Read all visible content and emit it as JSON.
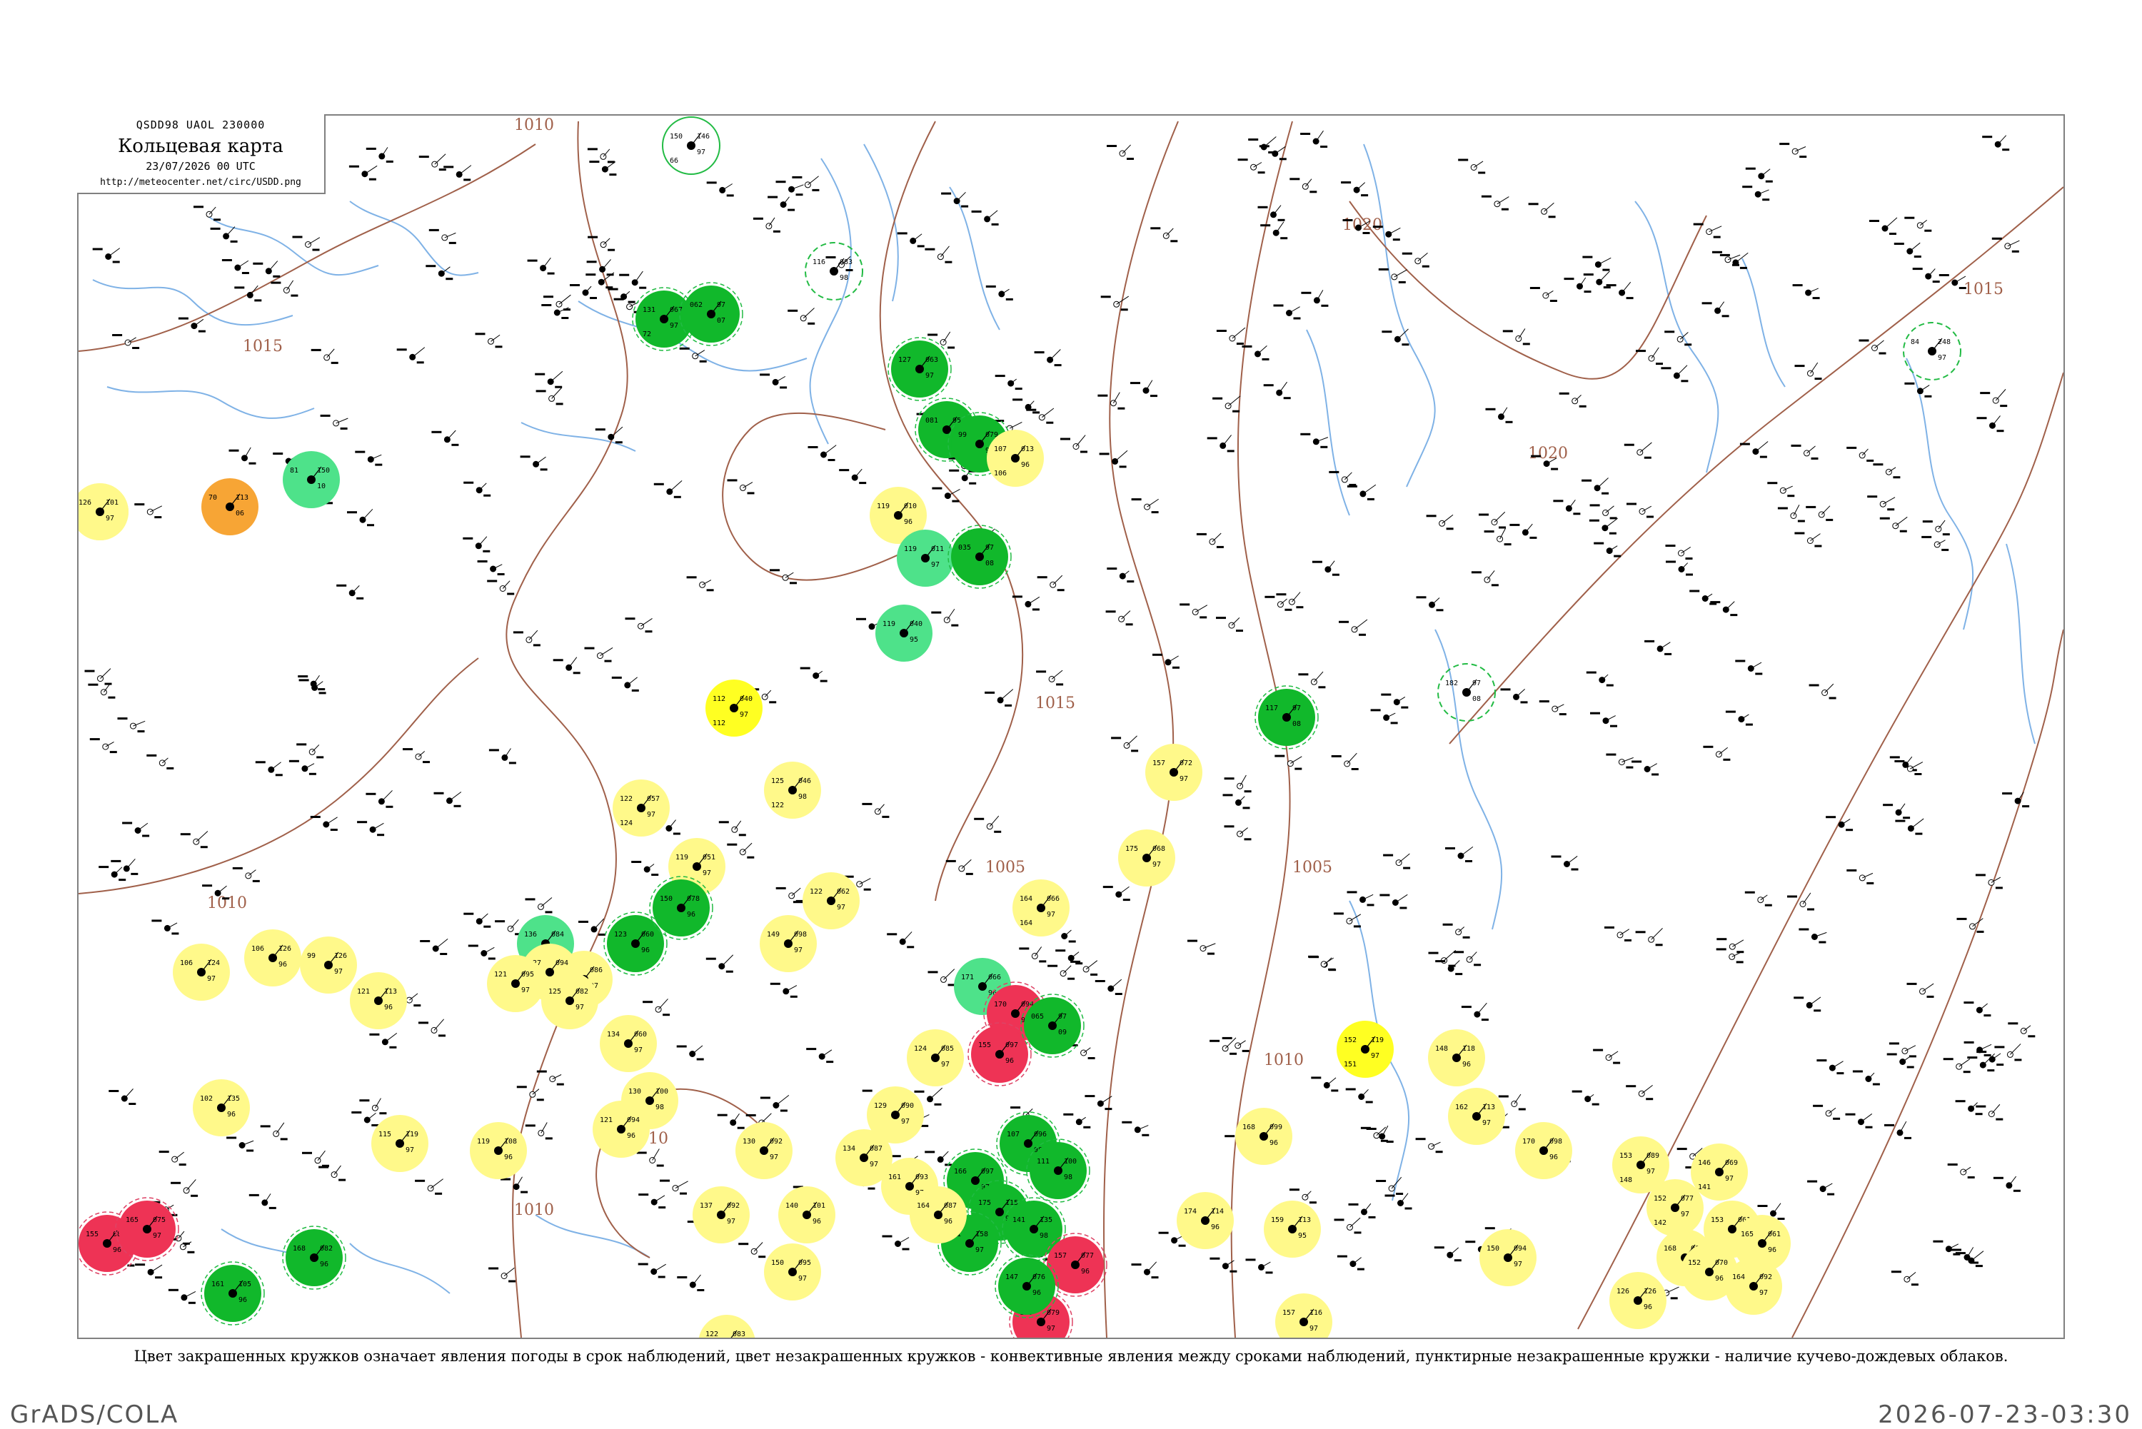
{
  "header": {
    "bulletin": "QSDD98  UAOL  230000",
    "title": "Кольцевая карта",
    "date": "23/07/2026 00 UTC",
    "url": "http://meteocenter.net/circ/USDD.png"
  },
  "legend_caption": "Цвет закрашенных кружков означает явления погоды в срок наблюдений, цвет незакрашенных кружков - конвективные явления между сроками наблюдений, пунктирные незакрашенные кружки - наличие кучево-дождевых облаков.",
  "footer": {
    "left": "GrADS/COLA",
    "right": "2026-07-23-03:30"
  },
  "colors": {
    "frame": "#808080",
    "isobar": "#a0604a",
    "river": "#7fb2e6",
    "green_fill": "#11b82b",
    "light_green_fill": "#4ee28a",
    "yellow_fill": "#fff98a",
    "bright_yellow_fill": "#ffff22",
    "orange_fill": "#f7a535",
    "red_fill": "#ee3355",
    "dashed_green": "#22bb44",
    "ring_red": "#dd4466"
  },
  "isobar_labels": [
    "1010",
    "1015",
    "1005",
    "1020",
    "1015",
    "1015",
    "1010",
    "1020",
    "1010",
    "1005",
    "1010",
    "1010"
  ],
  "stations": [
    {
      "a": "124",
      "b": "97",
      "c": "09",
      "d": "124",
      "fill": "yellow"
    },
    {
      "a": "70",
      "b": "113",
      "c": "06",
      "d": "",
      "fill": "orange"
    },
    {
      "a": "81",
      "b": "150",
      "c": "10",
      "d": "",
      "fill": "light-green"
    },
    {
      "a": "131",
      "b": "067",
      "c": "97",
      "d": "72",
      "fill": "green"
    },
    {
      "a": "062",
      "b": "97",
      "c": "07",
      "d": "",
      "fill": "green"
    },
    {
      "a": "150",
      "b": "146",
      "c": "97",
      "d": "66",
      "fill": "ring-green"
    },
    {
      "a": "116",
      "b": "083",
      "c": "98",
      "d": "",
      "fill": "dash-green"
    },
    {
      "a": "127",
      "b": "063",
      "c": "97",
      "d": "",
      "fill": "green"
    },
    {
      "a": "081",
      "b": "95",
      "c": "05",
      "d": "",
      "fill": "green"
    },
    {
      "a": "99",
      "b": "079",
      "c": "95",
      "d": "",
      "fill": "green"
    },
    {
      "a": "107",
      "b": "013",
      "c": "96",
      "d": "106",
      "fill": "yellow"
    },
    {
      "a": "119",
      "b": "010",
      "c": "96",
      "d": "",
      "fill": "yellow"
    },
    {
      "a": "119",
      "b": "011",
      "c": "97",
      "d": "",
      "fill": "light-green"
    },
    {
      "a": "035",
      "b": "97",
      "c": "08",
      "d": "",
      "fill": "green"
    },
    {
      "a": "119",
      "b": "040",
      "c": "95",
      "d": "",
      "fill": "light-green"
    },
    {
      "a": "112",
      "b": "040",
      "c": "97",
      "d": "112",
      "fill": "bright-yellow"
    },
    {
      "a": "84",
      "b": "248",
      "c": "97",
      "d": "",
      "fill": "dash-green"
    },
    {
      "a": "182",
      "b": "97",
      "c": "08",
      "d": "",
      "fill": "dash-green"
    },
    {
      "a": "117",
      "b": "97",
      "c": "08",
      "d": "",
      "fill": "green"
    },
    {
      "a": "125",
      "b": "046",
      "c": "98",
      "d": "122",
      "fill": "yellow"
    },
    {
      "a": "122",
      "b": "057",
      "c": "97",
      "d": "124",
      "fill": "yellow"
    },
    {
      "a": "119",
      "b": "051",
      "c": "97",
      "d": "",
      "fill": "yellow"
    },
    {
      "a": "149",
      "b": "098",
      "c": "97",
      "d": "",
      "fill": "yellow"
    },
    {
      "a": "157",
      "b": "072",
      "c": "97",
      "d": "",
      "fill": "yellow"
    },
    {
      "a": "175",
      "b": "068",
      "c": "97",
      "d": "",
      "fill": "yellow"
    },
    {
      "a": "164",
      "b": "066",
      "c": "97",
      "d": "164",
      "fill": "yellow"
    },
    {
      "a": "136",
      "b": "084",
      "c": "95",
      "d": "",
      "fill": "light-green"
    },
    {
      "a": "123",
      "b": "060",
      "c": "96",
      "d": "",
      "fill": "green"
    },
    {
      "a": "171",
      "b": "066",
      "c": "96",
      "d": "",
      "fill": "light-green"
    },
    {
      "a": "170",
      "b": "094",
      "c": "96",
      "d": "",
      "fill": "red"
    },
    {
      "a": "065",
      "b": "97",
      "c": "09",
      "d": "",
      "fill": "green"
    },
    {
      "a": "155",
      "b": "097",
      "c": "96",
      "d": "",
      "fill": "red"
    },
    {
      "a": "152",
      "b": "119",
      "c": "97",
      "d": "151",
      "fill": "bright-yellow"
    },
    {
      "a": "148",
      "b": "118",
      "c": "96",
      "d": "",
      "fill": "yellow"
    },
    {
      "a": "162",
      "b": "113",
      "c": "97",
      "d": "",
      "fill": "yellow"
    },
    {
      "a": "170",
      "b": "098",
      "c": "96",
      "d": "",
      "fill": "yellow"
    },
    {
      "a": "153",
      "b": "089",
      "c": "97",
      "d": "148",
      "fill": "yellow"
    },
    {
      "a": "146",
      "b": "069",
      "c": "97",
      "d": "141",
      "fill": "yellow"
    },
    {
      "a": "152",
      "b": "077",
      "c": "97",
      "d": "142",
      "fill": "yellow"
    },
    {
      "a": "153",
      "b": "061",
      "c": "97",
      "d": "",
      "fill": "yellow"
    },
    {
      "a": "165",
      "b": "061",
      "c": "96",
      "d": "",
      "fill": "yellow"
    },
    {
      "a": "168",
      "b": "068",
      "c": "96",
      "d": "",
      "fill": "yellow"
    },
    {
      "a": "152",
      "b": "070",
      "c": "96",
      "d": "",
      "fill": "yellow"
    },
    {
      "a": "164",
      "b": "092",
      "c": "97",
      "d": "",
      "fill": "yellow"
    },
    {
      "a": "150",
      "b": "094",
      "c": "97",
      "d": "",
      "fill": "yellow"
    },
    {
      "a": "126",
      "b": "126",
      "c": "96",
      "d": "",
      "fill": "yellow"
    },
    {
      "a": "157",
      "b": "116",
      "c": "97",
      "d": "",
      "fill": "yellow"
    },
    {
      "a": "174",
      "b": "114",
      "c": "96",
      "d": "",
      "fill": "yellow"
    },
    {
      "a": "159",
      "b": "113",
      "c": "95",
      "d": "",
      "fill": "yellow"
    },
    {
      "a": "168",
      "b": "099",
      "c": "96",
      "d": "",
      "fill": "yellow"
    },
    {
      "a": "102",
      "b": "135",
      "c": "96",
      "d": "",
      "fill": "yellow"
    },
    {
      "a": "115",
      "b": "119",
      "c": "97",
      "d": "",
      "fill": "yellow"
    },
    {
      "a": "119",
      "b": "108",
      "c": "96",
      "d": "",
      "fill": "yellow"
    },
    {
      "a": "106",
      "b": "124",
      "c": "97",
      "d": "",
      "fill": "yellow"
    },
    {
      "a": "106",
      "b": "126",
      "c": "96",
      "d": "",
      "fill": "yellow"
    },
    {
      "a": "99",
      "b": "126",
      "c": "97",
      "d": "",
      "fill": "yellow"
    },
    {
      "a": "121",
      "b": "113",
      "c": "96",
      "d": "",
      "fill": "yellow"
    },
    {
      "a": "107",
      "b": "096",
      "c": "98",
      "d": "",
      "fill": "green"
    },
    {
      "a": "111",
      "b": "100",
      "c": "98",
      "d": "",
      "fill": "green"
    },
    {
      "a": "166",
      "b": "097",
      "c": "97",
      "d": "",
      "fill": "green"
    },
    {
      "a": "175",
      "b": "115",
      "c": "96",
      "d": "",
      "fill": "green"
    },
    {
      "a": "141",
      "b": "135",
      "c": "98",
      "d": "",
      "fill": "green"
    },
    {
      "a": "141",
      "b": "158",
      "c": "97",
      "d": "",
      "fill": "green"
    },
    {
      "a": "155",
      "b": "083",
      "c": "96",
      "d": "",
      "fill": "red"
    },
    {
      "a": "165",
      "b": "075",
      "c": "97",
      "d": "",
      "fill": "red"
    },
    {
      "a": "168",
      "b": "082",
      "c": "96",
      "d": "",
      "fill": "green"
    },
    {
      "a": "161",
      "b": "105",
      "c": "96",
      "d": "",
      "fill": "green"
    },
    {
      "a": "176",
      "b": "079",
      "c": "97",
      "d": "",
      "fill": "red"
    },
    {
      "a": "157",
      "b": "077",
      "c": "96",
      "d": "",
      "fill": "red"
    },
    {
      "a": "147",
      "b": "076",
      "c": "96",
      "d": "",
      "fill": "green"
    },
    {
      "a": "150",
      "b": "078",
      "c": "96",
      "d": "",
      "fill": "green"
    },
    {
      "a": "133",
      "b": "086",
      "c": "97",
      "d": "",
      "fill": "yellow"
    },
    {
      "a": "127",
      "b": "094",
      "c": "96",
      "d": "",
      "fill": "yellow"
    },
    {
      "a": "121",
      "b": "095",
      "c": "97",
      "d": "",
      "fill": "yellow"
    },
    {
      "a": "125",
      "b": "082",
      "c": "97",
      "d": "",
      "fill": "yellow"
    },
    {
      "a": "124",
      "b": "085",
      "c": "97",
      "d": "",
      "fill": "yellow"
    },
    {
      "a": "129",
      "b": "090",
      "c": "97",
      "d": "",
      "fill": "yellow"
    },
    {
      "a": "134",
      "b": "087",
      "c": "97",
      "d": "",
      "fill": "yellow"
    },
    {
      "a": "134",
      "b": "060",
      "c": "97",
      "d": "",
      "fill": "yellow"
    },
    {
      "a": "122",
      "b": "062",
      "c": "97",
      "d": "",
      "fill": "yellow"
    },
    {
      "a": "130",
      "b": "092",
      "c": "97",
      "d": "",
      "fill": "yellow"
    },
    {
      "a": "161",
      "b": "093",
      "c": "97",
      "d": "",
      "fill": "yellow"
    },
    {
      "a": "164",
      "b": "087",
      "c": "96",
      "d": "",
      "fill": "yellow"
    },
    {
      "a": "137",
      "b": "092",
      "c": "97",
      "d": "",
      "fill": "yellow"
    },
    {
      "a": "150",
      "b": "095",
      "c": "97",
      "d": "",
      "fill": "yellow"
    },
    {
      "a": "122",
      "b": "083",
      "c": "96",
      "d": "",
      "fill": "yellow"
    },
    {
      "a": "140",
      "b": "101",
      "c": "96",
      "d": "",
      "fill": "yellow"
    },
    {
      "a": "130",
      "b": "100",
      "c": "98",
      "d": "",
      "fill": "yellow"
    },
    {
      "a": "121",
      "b": "094",
      "c": "96",
      "d": "",
      "fill": "yellow"
    },
    {
      "a": "126",
      "b": "101",
      "c": "97",
      "d": "",
      "fill": "yellow"
    }
  ]
}
